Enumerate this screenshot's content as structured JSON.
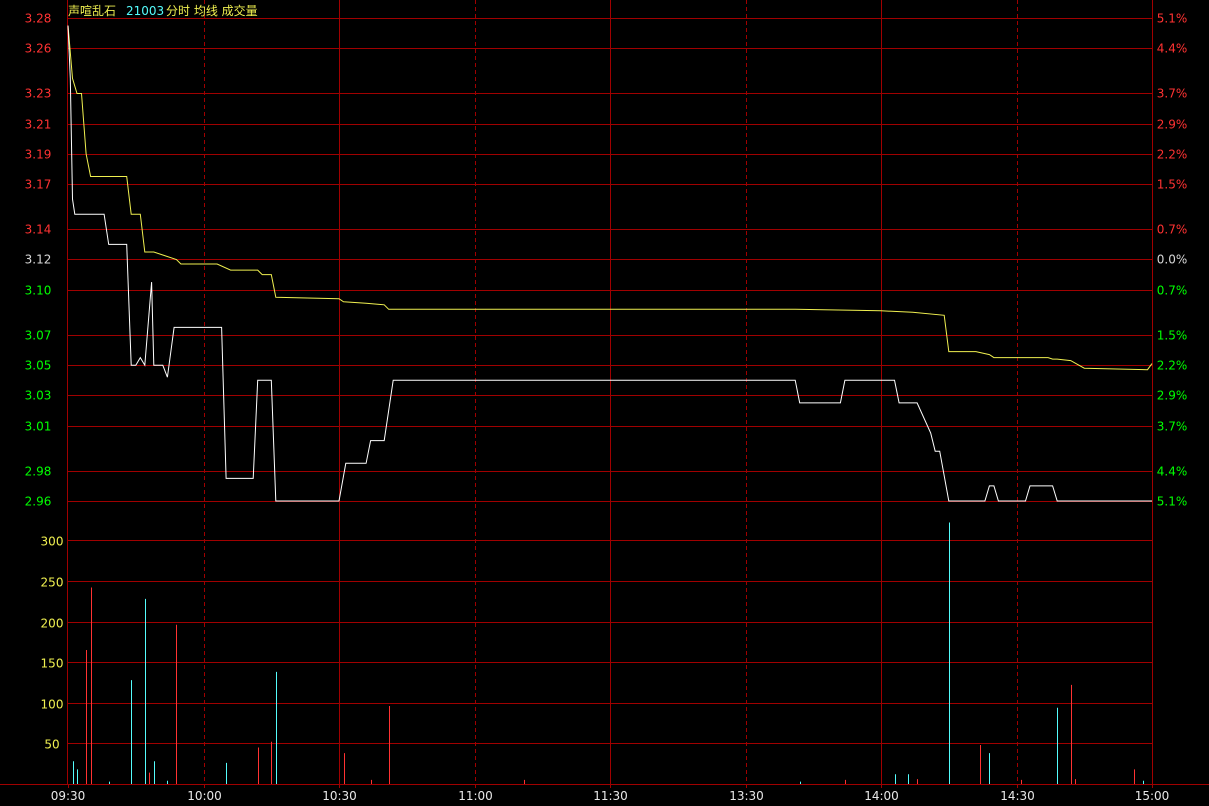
{
  "header": {
    "name": "声喧乱石",
    "code": "21003",
    "tags": "分时 均线 成交量"
  },
  "colors": {
    "background": "#000000",
    "grid": "#a00000",
    "up": "#ff3232",
    "down": "#54fcfc",
    "price_line": "#ffffff",
    "avg_line": "#f0f050",
    "label_up": "#ff3232",
    "label_down": "#00ff00",
    "label_neutral": "#d8d8d8",
    "vol_label": "#f0f050",
    "time_label": "#e8e8e8",
    "title_name": "#f0f050",
    "title_code": "#54fcfc"
  },
  "chart_data": {
    "type": "line",
    "price_axis": {
      "ylim": [
        2.955,
        3.285
      ],
      "ticks": [
        {
          "value": 3.28,
          "label": "3.28",
          "pct": "5.1%",
          "side": "up"
        },
        {
          "value": 3.26,
          "label": "3.26",
          "pct": "4.4%",
          "side": "up"
        },
        {
          "value": 3.23,
          "label": "3.23",
          "pct": "3.7%",
          "side": "up"
        },
        {
          "value": 3.21,
          "label": "3.21",
          "pct": "2.9%",
          "side": "up"
        },
        {
          "value": 3.19,
          "label": "3.19",
          "pct": "2.2%",
          "side": "up"
        },
        {
          "value": 3.17,
          "label": "3.17",
          "pct": "1.5%",
          "side": "up"
        },
        {
          "value": 3.14,
          "label": "3.14",
          "pct": "0.7%",
          "side": "up"
        },
        {
          "value": 3.12,
          "label": "3.12",
          "pct": "0.0%",
          "side": "neutral"
        },
        {
          "value": 3.1,
          "label": "3.10",
          "pct": "0.7%",
          "side": "down"
        },
        {
          "value": 3.07,
          "label": "3.07",
          "pct": "1.5%",
          "side": "down"
        },
        {
          "value": 3.05,
          "label": "3.05",
          "pct": "2.2%",
          "side": "down"
        },
        {
          "value": 3.03,
          "label": "3.03",
          "pct": "2.9%",
          "side": "down"
        },
        {
          "value": 3.01,
          "label": "3.01",
          "pct": "3.7%",
          "side": "down"
        },
        {
          "value": 2.98,
          "label": "2.98",
          "pct": "4.4%",
          "side": "down"
        },
        {
          "value": 2.96,
          "label": "2.96",
          "pct": "5.1%",
          "side": "down"
        }
      ]
    },
    "volume_axis": {
      "ylim": [
        0,
        330
      ],
      "ticks": [
        {
          "value": 300,
          "label": "300"
        },
        {
          "value": 250,
          "label": "250"
        },
        {
          "value": 200,
          "label": "200"
        },
        {
          "value": 150,
          "label": "150"
        },
        {
          "value": 100,
          "label": "100"
        },
        {
          "value": 50,
          "label": "50"
        }
      ]
    },
    "time_ticks": [
      {
        "minute": 0,
        "label": "09:30"
      },
      {
        "minute": 30,
        "label": "10:00"
      },
      {
        "minute": 60,
        "label": "10:30"
      },
      {
        "minute": 90,
        "label": "11:00"
      },
      {
        "minute": 120,
        "label": "11:30"
      },
      {
        "minute": 150,
        "label": "13:30"
      },
      {
        "minute": 180,
        "label": "14:00"
      },
      {
        "minute": 210,
        "label": "14:30"
      },
      {
        "minute": 240,
        "label": "15:00"
      }
    ],
    "solid_time_gridlines": [
      60,
      120,
      180
    ],
    "price": [
      [
        0,
        3.275
      ],
      [
        0.5,
        3.24
      ],
      [
        1,
        3.16
      ],
      [
        1.5,
        3.15
      ],
      [
        8,
        3.15
      ],
      [
        9,
        3.13
      ],
      [
        13,
        3.13
      ],
      [
        14,
        3.05
      ],
      [
        15,
        3.05
      ],
      [
        16,
        3.055
      ],
      [
        17,
        3.05
      ],
      [
        18.5,
        3.105
      ],
      [
        19,
        3.05
      ],
      [
        21,
        3.05
      ],
      [
        22,
        3.042
      ],
      [
        23.5,
        3.075
      ],
      [
        34,
        3.075
      ],
      [
        35,
        2.975
      ],
      [
        41,
        2.975
      ],
      [
        42,
        3.04
      ],
      [
        45,
        3.04
      ],
      [
        46,
        2.96
      ],
      [
        60,
        2.96
      ],
      [
        61.5,
        2.985
      ],
      [
        66,
        2.985
      ],
      [
        67,
        3.0
      ],
      [
        70,
        3.0
      ],
      [
        72,
        3.04
      ],
      [
        161,
        3.04
      ],
      [
        162,
        3.025
      ],
      [
        171,
        3.025
      ],
      [
        172,
        3.04
      ],
      [
        183,
        3.04
      ],
      [
        184,
        3.025
      ],
      [
        188,
        3.025
      ],
      [
        191,
        3.005
      ],
      [
        192,
        2.993
      ],
      [
        193,
        2.993
      ],
      [
        195,
        2.96
      ],
      [
        203,
        2.96
      ],
      [
        204,
        2.97
      ],
      [
        205,
        2.97
      ],
      [
        206,
        2.96
      ],
      [
        212,
        2.96
      ],
      [
        213,
        2.97
      ],
      [
        218,
        2.97
      ],
      [
        219,
        2.96
      ],
      [
        240,
        2.96
      ]
    ],
    "avg": [
      [
        0,
        3.275
      ],
      [
        1,
        3.24
      ],
      [
        2,
        3.23
      ],
      [
        3,
        3.23
      ],
      [
        4,
        3.19
      ],
      [
        5,
        3.175
      ],
      [
        13,
        3.175
      ],
      [
        14,
        3.15
      ],
      [
        16,
        3.15
      ],
      [
        17,
        3.125
      ],
      [
        19,
        3.125
      ],
      [
        21,
        3.123
      ],
      [
        24,
        3.12
      ],
      [
        25,
        3.117
      ],
      [
        33,
        3.117
      ],
      [
        36,
        3.113
      ],
      [
        42,
        3.113
      ],
      [
        43,
        3.11
      ],
      [
        45,
        3.11
      ],
      [
        46,
        3.095
      ],
      [
        60,
        3.094
      ],
      [
        61,
        3.092
      ],
      [
        66,
        3.091
      ],
      [
        70,
        3.09
      ],
      [
        71,
        3.087
      ],
      [
        161,
        3.087
      ],
      [
        180,
        3.086
      ],
      [
        187,
        3.085
      ],
      [
        194,
        3.083
      ],
      [
        195,
        3.059
      ],
      [
        201,
        3.059
      ],
      [
        204,
        3.057
      ],
      [
        205,
        3.055
      ],
      [
        217,
        3.055
      ],
      [
        218,
        3.054
      ],
      [
        219,
        3.054
      ],
      [
        222,
        3.053
      ],
      [
        225,
        3.048
      ],
      [
        239,
        3.047
      ],
      [
        240,
        3.051
      ]
    ],
    "volume": [
      [
        1,
        28,
        "down"
      ],
      [
        2,
        18,
        "down"
      ],
      [
        4,
        165,
        "up"
      ],
      [
        5,
        242,
        "up"
      ],
      [
        9,
        3,
        "down"
      ],
      [
        14,
        128,
        "down"
      ],
      [
        17,
        228,
        "down"
      ],
      [
        18,
        14,
        "up"
      ],
      [
        19,
        28,
        "down"
      ],
      [
        22,
        4,
        "down"
      ],
      [
        24,
        196,
        "up"
      ],
      [
        35,
        26,
        "down"
      ],
      [
        42,
        45,
        "up"
      ],
      [
        45,
        52,
        "up"
      ],
      [
        46,
        138,
        "down"
      ],
      [
        61,
        38,
        "up"
      ],
      [
        67,
        5,
        "up"
      ],
      [
        71,
        96,
        "up"
      ],
      [
        101,
        5,
        "up"
      ],
      [
        162,
        3,
        "down"
      ],
      [
        172,
        5,
        "up"
      ],
      [
        183,
        12,
        "down"
      ],
      [
        186,
        12,
        "down"
      ],
      [
        188,
        6,
        "up"
      ],
      [
        195,
        322,
        "down"
      ],
      [
        202,
        48,
        "up"
      ],
      [
        204,
        38,
        "down"
      ],
      [
        211,
        5,
        "up"
      ],
      [
        219,
        94,
        "down"
      ],
      [
        222,
        122,
        "up"
      ],
      [
        223,
        6,
        "up"
      ],
      [
        236,
        18,
        "up"
      ],
      [
        238,
        4,
        "down"
      ]
    ]
  }
}
